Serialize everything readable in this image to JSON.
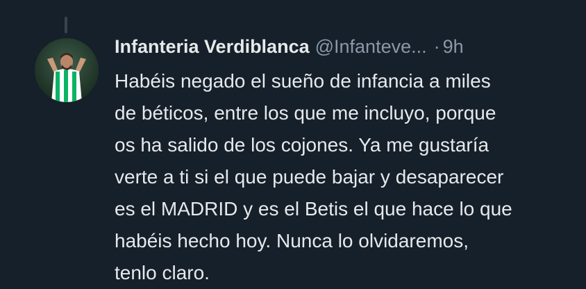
{
  "tweet": {
    "display_name": "Infanteria Verdiblanca",
    "handle": "@Infanteve...",
    "separator": "·",
    "time": "9h",
    "avatar_icon": "player-avatar-icon",
    "lines": [
      "Habéis negado el sueño de infancia a miles",
      "de béticos, entre los que me incluyo, porque",
      "os ha salido de los cojones. Ya me gustaría",
      "verte a ti si el que puede bajar y desaparecer",
      "es el MADRID y es el Betis el que hace lo que",
      "habéis hecho hoy. Nunca lo olvidaremos,",
      "tenlo claro."
    ]
  },
  "colors": {
    "background": "#15202b",
    "text_primary": "#e7e9ea",
    "text_secondary": "#8b98a5",
    "thread_line": "#38444d",
    "betis_green": "#0bb363"
  }
}
